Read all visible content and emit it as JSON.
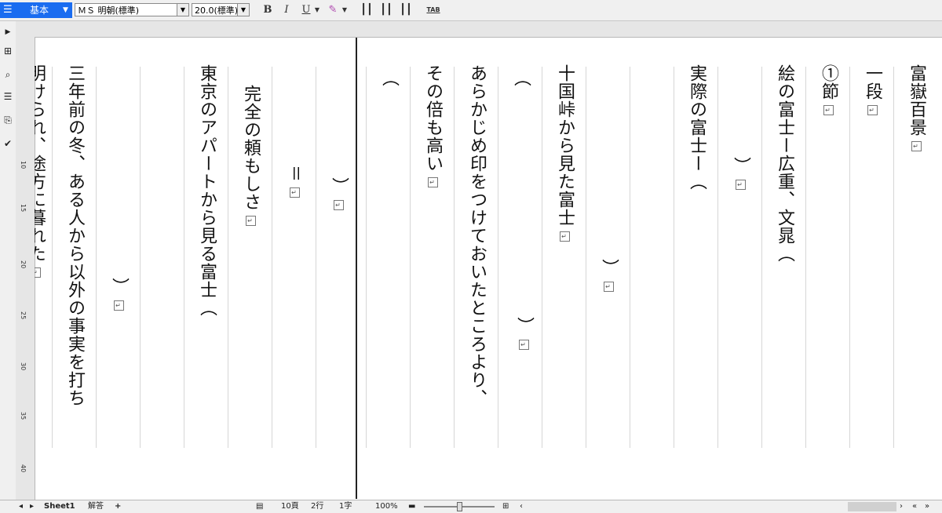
{
  "toolbar": {
    "style_label": "基本",
    "font_name": "ＭＳ 明朝(標準)",
    "font_size": "20.0(標準)",
    "bold": "B",
    "italic": "I",
    "underline": "U",
    "tab": "TAB"
  },
  "ruler": {
    "marks": [
      "10",
      "15",
      "20",
      "25",
      "30",
      "35",
      "40"
    ]
  },
  "document": {
    "columns": [
      {
        "text": "富嶽百景",
        "ret": true
      },
      {
        "text": "一段",
        "ret": true
      },
      {
        "text": "①節",
        "ret": true
      },
      {
        "text": "絵の富士ー広重、文晁（",
        "ret": false
      },
      {
        "text": "）",
        "ret": true
      },
      {
        "text": "実際の富士ー（",
        "ret": false
      },
      {
        "text": "）",
        "ret": true
      },
      {
        "text": "十国峠から見た富士",
        "ret": true
      },
      {
        "text": "（",
        "ret": false
      },
      {
        "text": "あらかじめ印をつけておいたところより、",
        "ret": false
      },
      {
        "text": "その倍も高い",
        "ret": true
      },
      {
        "text": "（",
        "ret": false
      },
      {
        "text": "）",
        "ret": true
      },
      {
        "text": "＝",
        "ret": true
      },
      {
        "text": "完全の頼もしさ",
        "ret": true
      },
      {
        "text": "東京のアパートから見る富士（",
        "ret": false
      },
      {
        "text": "）",
        "ret": true
      },
      {
        "text": "三年前の冬、ある人から以外の事実を打ち",
        "ret": false
      },
      {
        "text": "明けられ、途方に暮れた",
        "ret": true
      }
    ]
  },
  "status": {
    "sheet1": "Sheet1",
    "sheet2": "解答",
    "add": "+",
    "page": "10頁",
    "line": "2行",
    "char": "1字",
    "zoom": "100%"
  }
}
